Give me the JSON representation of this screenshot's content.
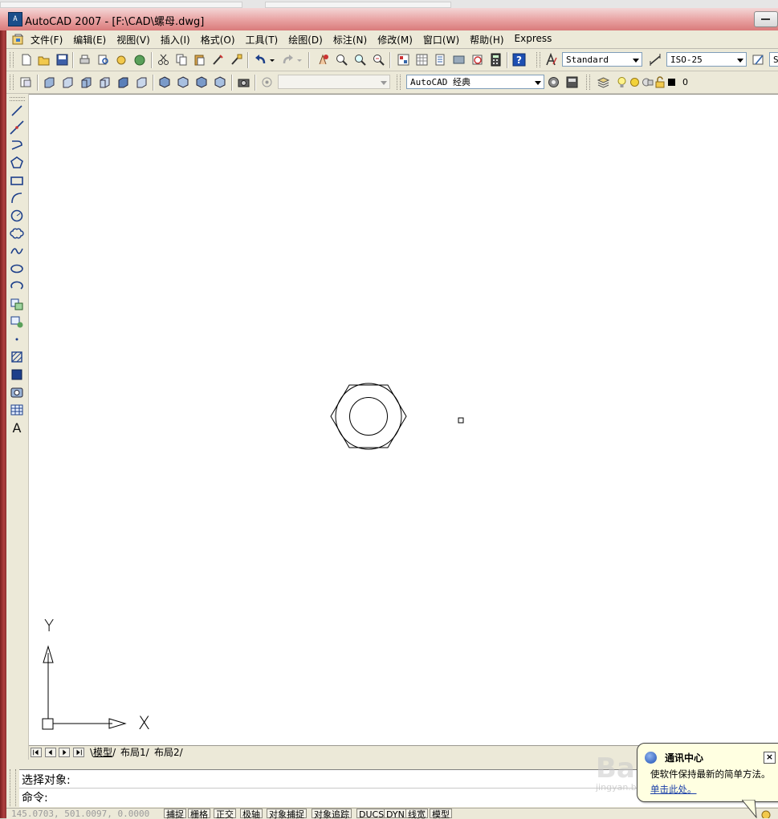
{
  "window": {
    "title": "AutoCAD 2007 - [F:\\CAD\\螺母.dwg]",
    "app_icon_glyph": "A"
  },
  "menu": [
    "文件(F)",
    "编辑(E)",
    "视图(V)",
    "插入(I)",
    "格式(O)",
    "工具(T)",
    "绘图(D)",
    "标注(N)",
    "修改(M)",
    "窗口(W)",
    "帮助(H)",
    "Express"
  ],
  "toolbar1": {
    "text_style": "Standard",
    "dim_style": "ISO-25",
    "truncated": "S"
  },
  "toolbar2": {
    "view_combo": "",
    "workspace": "AutoCAD 经典",
    "layer": "0"
  },
  "ucs": {
    "x_label": "X",
    "y_label": "Y"
  },
  "layout_tabs": [
    "模型",
    "布局1",
    "布局2"
  ],
  "command": {
    "line1": "选择对象:",
    "line2": "命令:"
  },
  "status": {
    "coords": "145.0703, 501.0097, 0.0000",
    "buttons": [
      "捕捉",
      "栅格",
      "正交",
      "极轴",
      "对象捕捉",
      "对象追踪",
      "DUCS",
      "DYN",
      "线宽",
      "模型"
    ]
  },
  "notification": {
    "title": "通讯中心",
    "message": "使软件保持最新的简单方法。",
    "link": "单击此处。"
  },
  "watermark": {
    "text": "Baidu经验",
    "url": "jingyan.baidu.com"
  },
  "colors": {
    "title_bar": "#e8a0a0",
    "canvas": "#ffffff",
    "chrome": "#ece9d8",
    "balloon": "#ffffe1"
  }
}
